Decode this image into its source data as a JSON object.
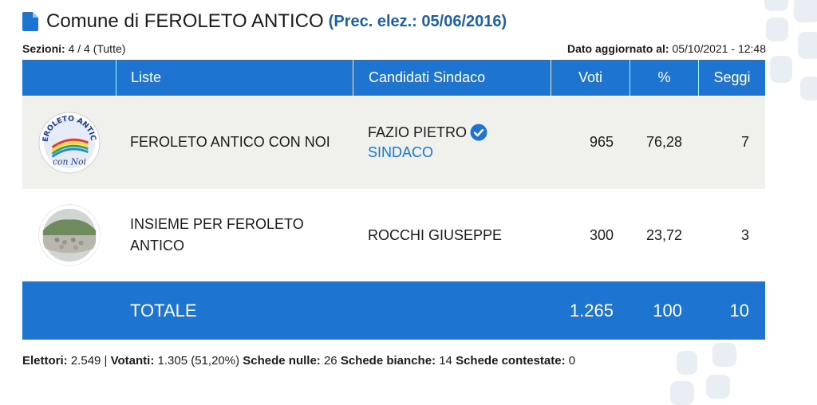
{
  "page": {
    "title": "Comune di FEROLETO ANTICO",
    "prev_election": "(Prec. elez.: 05/06/2016)"
  },
  "meta": {
    "sections_label": "Sezioni:",
    "sections_value": "4 / 4 (Tutte)",
    "updated_label": "Dato aggiornato al:",
    "updated_value": "05/10/2021 - 12:48"
  },
  "table": {
    "headers": [
      "",
      "Liste",
      "Candidati Sindaco",
      "Voti",
      "%",
      "Seggi"
    ],
    "rows": [
      {
        "logo_text_top": "FEROLETO ANTICO",
        "logo_text_bottom": "con Noi",
        "list": "FEROLETO ANTICO CON NOI",
        "candidate": "FAZIO PIETRO",
        "candidate_role": "SINDACO",
        "votes": "965",
        "percent": "76,28",
        "seats": "7"
      },
      {
        "list_line1": "INSIEME PER FEROLETO",
        "list_line2": "ANTICO",
        "candidate": "ROCCHI GIUSEPPE",
        "votes": "300",
        "percent": "23,72",
        "seats": "3"
      }
    ],
    "total": {
      "label": "TOTALE",
      "votes": "1.265",
      "percent": "100",
      "seats": "10"
    }
  },
  "footer": {
    "electors_label": "Elettori:",
    "electors_value": "2.549 |",
    "voters_label": "Votanti:",
    "voters_value": "1.305 (51,20%)",
    "null_label": "Schede nulle:",
    "null_value": "26",
    "blank_label": "Schede bianche:",
    "blank_value": "14",
    "contested_label": "Schede contestate:",
    "contested_value": "0"
  },
  "colors": {
    "accent": "#1e74d1",
    "title_accent": "#1f5fa8",
    "row_alt": "#f0f0ec"
  }
}
